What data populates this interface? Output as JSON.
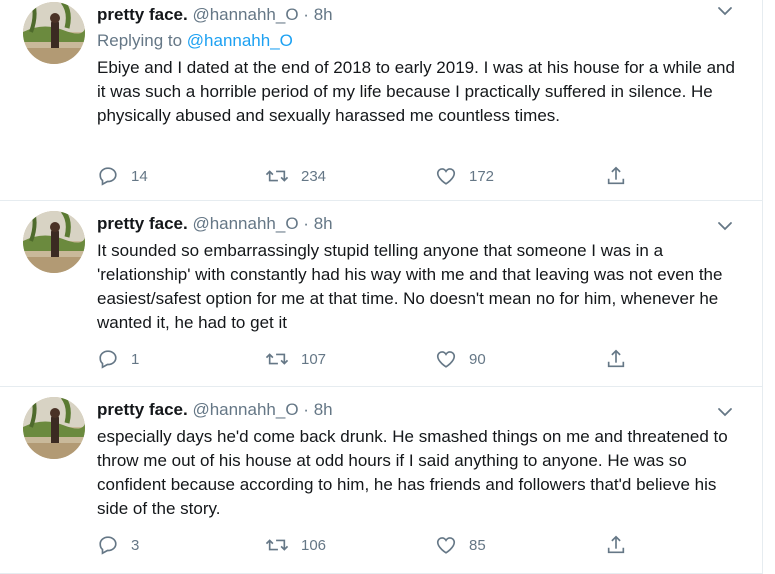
{
  "colors": {
    "text": "#14171a",
    "secondary": "#657786",
    "link": "#1da1f2",
    "border": "#e6ecf0"
  },
  "tweets": [
    {
      "name": "pretty face.",
      "handle": "@hannahh_O",
      "dot": "·",
      "time": "8h",
      "reply_prefix": "Replying to ",
      "reply_to": "@hannahh_O",
      "text": "Ebiye and I dated at the end of 2018 to early 2019. I was at his house for a while and it was such a horrible period of my life because I practically suffered in silence. He physically abused and sexually harassed me countless times.",
      "replies": "14",
      "retweets": "234",
      "likes": "172"
    },
    {
      "name": "pretty face.",
      "handle": "@hannahh_O",
      "dot": "·",
      "time": "8h",
      "text": "It sounded so embarrassingly stupid telling anyone that someone I was in a 'relationship' with constantly had his way with me and that leaving was not even the easiest/safest option for me at that time. No doesn't mean no for him, whenever he wanted it, he had to get it",
      "replies": "1",
      "retweets": "107",
      "likes": "90"
    },
    {
      "name": "pretty face.",
      "handle": "@hannahh_O",
      "dot": "·",
      "time": "8h",
      "text": "especially days he'd come back drunk. He smashed things on me and threatened to throw me out of his house at odd hours if I said anything to anyone. He was so confident because according to him, he has friends and followers that'd believe his side of the story.",
      "replies": "3",
      "retweets": "106",
      "likes": "85"
    }
  ]
}
